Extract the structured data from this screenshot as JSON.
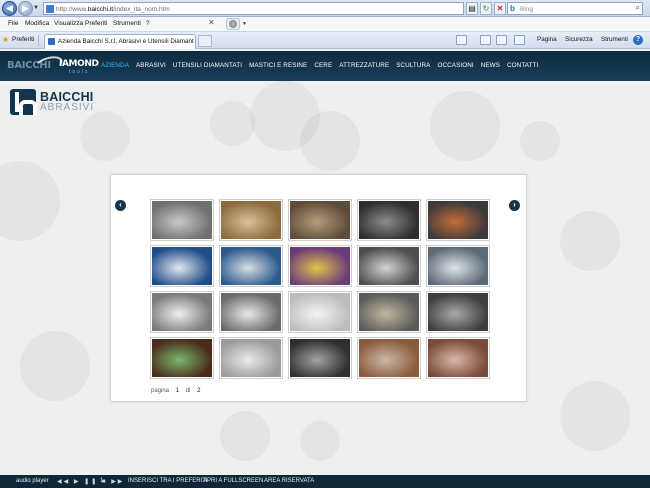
{
  "browser": {
    "url_prefix": "http://www.",
    "url_domain": "baicchi.it",
    "url_suffix": "/index_ita_nom.htm",
    "search_placeholder": "Bing",
    "menu": [
      "File",
      "Modifica",
      "Visualizza",
      "Preferiti",
      "Strumenti",
      "?"
    ],
    "favorites_label": "Preferiti",
    "tab_title": "Azienda Baicchi S.r.l. Abrasivi e Utensili Diamantati pe...",
    "commands": [
      "Pagina",
      "Sicurezza",
      "Strumenti"
    ]
  },
  "site": {
    "brand_left": "BAICCHI",
    "brand_right": "IAMOND",
    "brand_sub": "tools",
    "nav": [
      "AZIENDA",
      "ABRASIVI",
      "UTENSILI DIAMANTATI",
      "MASTICI E RESINE",
      "CERE",
      "ATTREZZATURE",
      "SCULTURA",
      "OCCASIONI",
      "NEWS",
      "CONTATTI"
    ],
    "active_nav": "AZIENDA",
    "logo_name": "BAICCHI",
    "logo_sub": "ABRASIVI"
  },
  "gallery": {
    "pager_label": "pagina",
    "current_page": "1",
    "of_label": "di",
    "total_pages": "2",
    "thumbnails": [
      "thumb-abrasive-wheels",
      "thumb-grinding-blocks",
      "thumb-diamond-segments",
      "thumb-cup-stones",
      "thumb-colored-abrasives",
      "thumb-resin-cans",
      "thumb-adhesive-pail",
      "thumb-spray-cans",
      "thumb-polishing-discs",
      "thumb-diamond-blade",
      "thumb-diamond-wire",
      "thumb-cutting-ring",
      "thumb-saw-blade-edge",
      "thumb-core-bit",
      "thumb-grinding-segments",
      "thumb-abrasive-rolls",
      "thumb-chisel-tips",
      "thumb-curved-blade",
      "thumb-sanding-disc",
      "thumb-core-drills"
    ]
  },
  "footer": {
    "audio_label": "audio player",
    "audio_track": "1",
    "links": [
      "INSERISCI TRA I PREFERITI",
      "APRI A FULLSCREEN",
      "AREA RISERVATA"
    ]
  }
}
